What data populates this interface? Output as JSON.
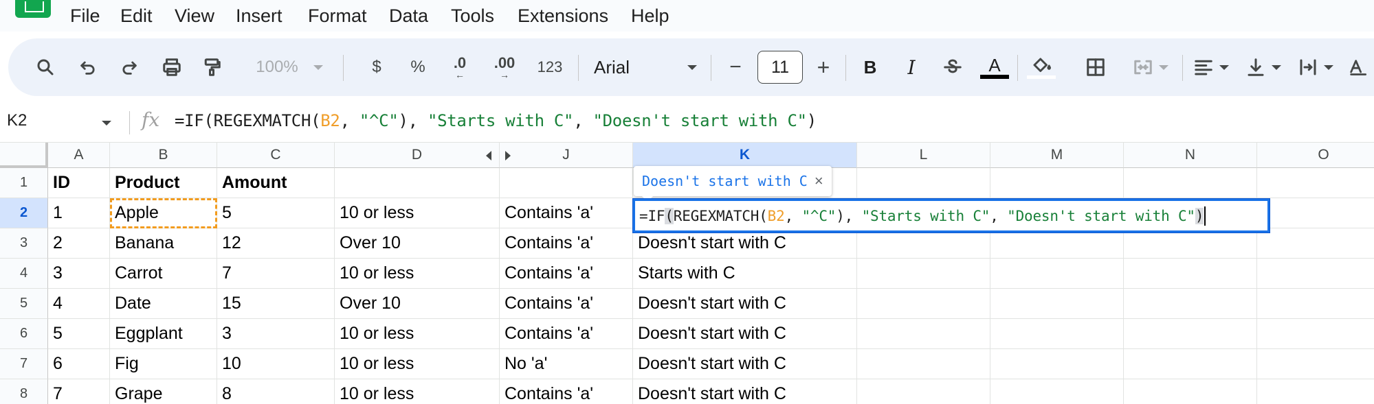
{
  "menu": [
    "File",
    "Edit",
    "View",
    "Insert",
    "Format",
    "Data",
    "Tools",
    "Extensions",
    "Help"
  ],
  "toolbar": {
    "zoom": "100%",
    "currency": "$",
    "percent": "%",
    "decrease_decimal": ".0",
    "increase_decimal": ".00",
    "number_format": "123",
    "font": "Arial",
    "font_size": "11",
    "minus": "−",
    "plus": "+",
    "bold": "B",
    "italic": "I",
    "text_color_letter": "A"
  },
  "formula_bar": {
    "name_box": "K2",
    "fx": "fx",
    "f_prefix": "=IF(REGEXMATCH(",
    "f_ref": "B2",
    "f_mid1": ", ",
    "f_str1": "\"^C\"",
    "f_mid2": "), ",
    "f_str2": "\"Starts with C\"",
    "f_mid3": ", ",
    "f_str3": "\"Doesn't start with C\"",
    "f_suffix": ")"
  },
  "columns": [
    {
      "key": "A",
      "label": "A"
    },
    {
      "key": "B",
      "label": "B"
    },
    {
      "key": "C",
      "label": "C"
    },
    {
      "key": "D",
      "label": "D"
    },
    {
      "key": "J",
      "label": "J"
    },
    {
      "key": "K",
      "label": "K"
    },
    {
      "key": "L",
      "label": "L"
    },
    {
      "key": "M",
      "label": "M"
    },
    {
      "key": "N",
      "label": "N"
    },
    {
      "key": "O",
      "label": "O"
    }
  ],
  "active_column": "K",
  "active_row": "2",
  "rows": [
    {
      "num": "1",
      "cells": {
        "A": "ID",
        "B": "Product",
        "C": "Amount",
        "D": "",
        "J": "",
        "K": ""
      }
    },
    {
      "num": "2",
      "cells": {
        "A": "1",
        "B": "Apple",
        "C": "5",
        "D": "10 or less",
        "J": "Contains 'a'",
        "K": ""
      }
    },
    {
      "num": "3",
      "cells": {
        "A": "2",
        "B": "Banana",
        "C": "12",
        "D": "Over 10",
        "J": "Contains 'a'",
        "K": "Doesn't start with C"
      }
    },
    {
      "num": "4",
      "cells": {
        "A": "3",
        "B": "Carrot",
        "C": "7",
        "D": "10 or less",
        "J": "Contains 'a'",
        "K": "Starts with C"
      }
    },
    {
      "num": "5",
      "cells": {
        "A": "4",
        "B": "Date",
        "C": "15",
        "D": "Over 10",
        "J": "Contains 'a'",
        "K": "Doesn't start with C"
      }
    },
    {
      "num": "6",
      "cells": {
        "A": "5",
        "B": "Eggplant",
        "C": "3",
        "D": "10 or less",
        "J": "Contains 'a'",
        "K": "Doesn't start with C"
      }
    },
    {
      "num": "7",
      "cells": {
        "A": "6",
        "B": "Fig",
        "C": "10",
        "D": "10 or less",
        "J": "No 'a'",
        "K": "Doesn't start with C"
      }
    },
    {
      "num": "8",
      "cells": {
        "A": "7",
        "B": "Grape",
        "C": "8",
        "D": "10 or less",
        "J": "Contains 'a'",
        "K": "Doesn't start with C"
      }
    }
  ],
  "editor": {
    "p1": "=IF",
    "paren": "(",
    "p2": "REGEXMATCH(",
    "ref": "B2",
    "p3": ", ",
    "s1": "\"^C\"",
    "p4": "), ",
    "s2": "\"Starts with C\"",
    "p5": ", ",
    "s3": "\"Doesn't start with C\"",
    "p6": ")"
  },
  "tooltip": {
    "text": "Doesn't start with C",
    "close": "×"
  },
  "colors": {
    "accent": "#1a73e8",
    "reference": "#f09e2a",
    "string": "#188038",
    "header_active": "#d3e3fd"
  }
}
